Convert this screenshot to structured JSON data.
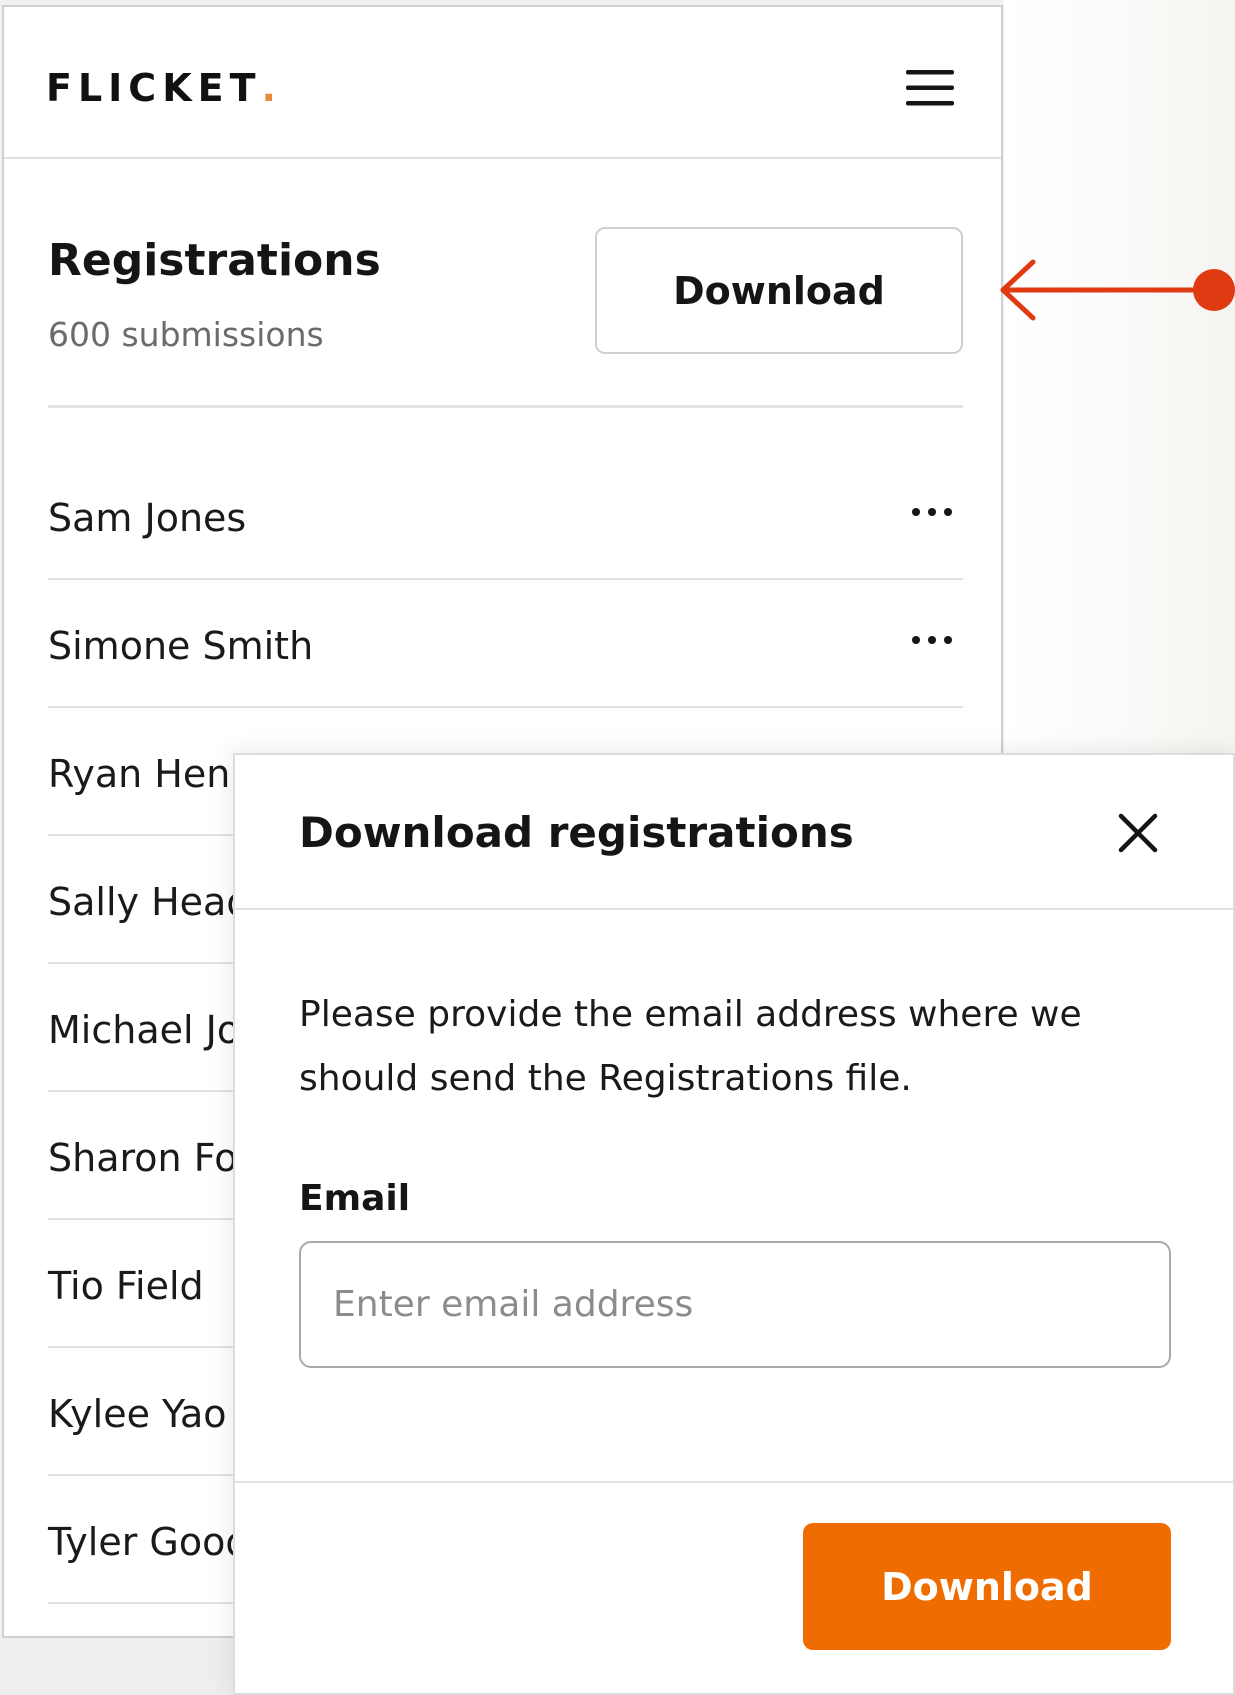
{
  "app": {
    "logo_text": "FLICKET",
    "logo_dot": ".",
    "brand_accent": "#e98a3a"
  },
  "header": {
    "menu_icon": "hamburger-menu-icon"
  },
  "registrations": {
    "title": "Registrations",
    "count_label": "600 submissions",
    "download_label": "Download",
    "row_action_icon": "more-horizontal-icon",
    "items": [
      {
        "name": "Sam Jones"
      },
      {
        "name": "Simone Smith"
      },
      {
        "name": "Ryan Henry"
      },
      {
        "name": "Sally Head"
      },
      {
        "name": "Michael Jones"
      },
      {
        "name": "Sharon Ford"
      },
      {
        "name": "Tio Field"
      },
      {
        "name": "Kylee Yao"
      },
      {
        "name": "Tyler Good"
      }
    ]
  },
  "annotation": {
    "color": "#e03a12",
    "icon": "arrow-left-icon"
  },
  "modal": {
    "title": "Download registrations",
    "close_icon": "close-icon",
    "description": "Please provide the email address where we should send the Registrations file.",
    "email_label": "Email",
    "email_value": "",
    "email_placeholder": "Enter email address",
    "download_label": "Download",
    "download_color": "#ef6c00"
  }
}
